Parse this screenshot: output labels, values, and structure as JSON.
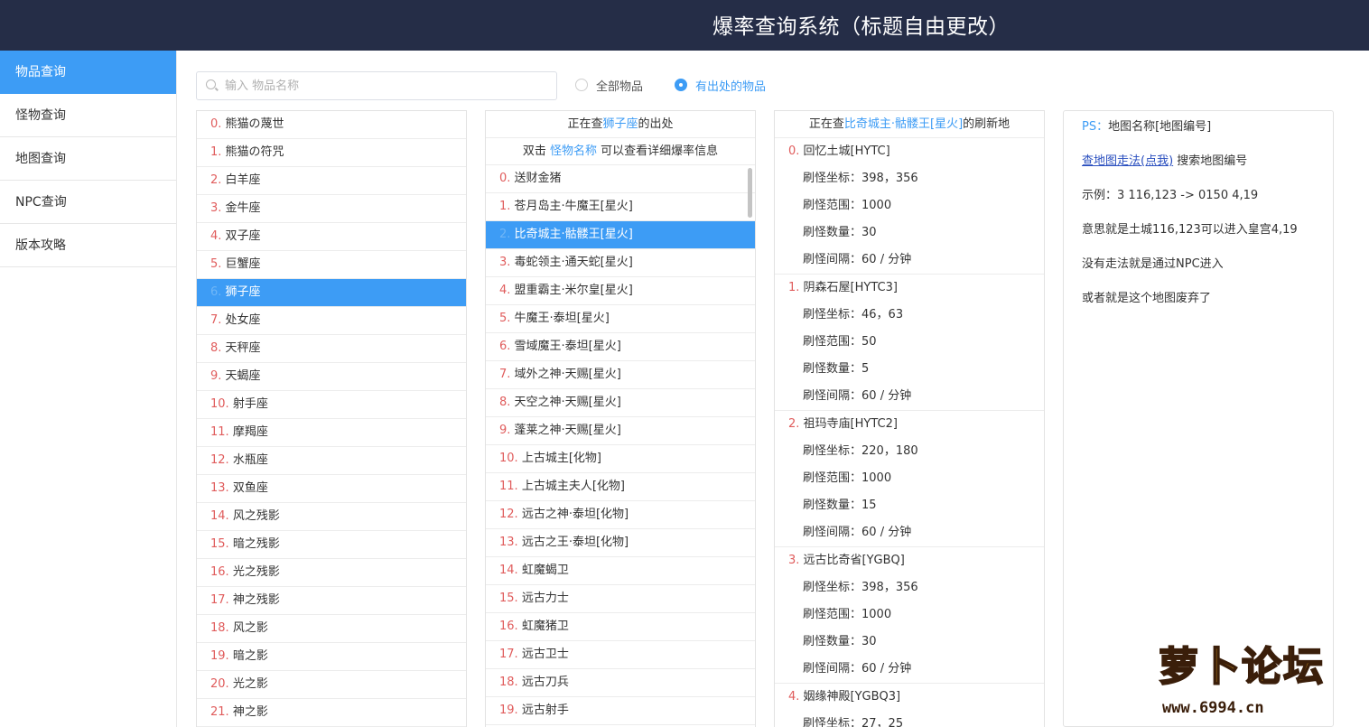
{
  "app": {
    "title": "爆率查询系统（标题自由更改）"
  },
  "sidebar": {
    "items": [
      {
        "label": "物品查询",
        "active": true
      },
      {
        "label": "怪物查询"
      },
      {
        "label": "地图查询"
      },
      {
        "label": "NPC查询"
      },
      {
        "label": "版本攻略"
      }
    ]
  },
  "search": {
    "placeholder": "输入 物品名称",
    "value": ""
  },
  "filters": {
    "all_label": "全部物品",
    "has_source_label": "有出处的物品",
    "selected": "has_source"
  },
  "items": {
    "selected_index": 6,
    "list": [
      "熊猫の蔑世",
      "熊猫の符咒",
      "白羊座",
      "金牛座",
      "双子座",
      "巨蟹座",
      "狮子座",
      "处女座",
      "天秤座",
      "天蝎座",
      "射手座",
      "摩羯座",
      "水瓶座",
      "双鱼座",
      "风之残影",
      "暗之残影",
      "光之残影",
      "神之残影",
      "风之影",
      "暗之影",
      "光之影",
      "神之影"
    ]
  },
  "sources": {
    "header_prefix": "正在查",
    "header_item": "狮子座",
    "header_suffix": "的出处",
    "hint_prefix": "双击",
    "hint_link": "怪物名称",
    "hint_suffix": "可以查看详细爆率信息",
    "selected_index": 2,
    "list": [
      "送财金猪",
      "苍月岛主·牛魔王[星火]",
      "比奇城主·骷髅王[星火]",
      "毒蛇领主·通天蛇[星火]",
      "盟重霸主·米尔皇[星火]",
      "牛魔王·泰坦[星火]",
      "雪域魔王·泰坦[星火]",
      "域外之神·天赐[星火]",
      "天空之神·天赐[星火]",
      "蓬莱之神·天赐[星火]",
      "上古城主[化物]",
      "上古城主夫人[化物]",
      "远古之神·泰坦[化物]",
      "远古之王·泰坦[化物]",
      "虹魔蝎卫",
      "远古力士",
      "虹魔猪卫",
      "远古卫士",
      "远古刀兵",
      "远古射手"
    ]
  },
  "spawns": {
    "header_prefix": "正在查",
    "header_monster": "比奇城主·骷髅王[星火]",
    "header_suffix": "的刷新地",
    "labels": {
      "coords": "刷怪坐标：",
      "range": "刷怪范围：",
      "count": "刷怪数量：",
      "interval": "刷怪间隔："
    },
    "list": [
      {
        "name": "回忆土城[HYTC]",
        "coords": "398，356",
        "range": "1000",
        "count": "30",
        "interval": "60 / 分钟"
      },
      {
        "name": "阴森石屋[HYTC3]",
        "coords": "46，63",
        "range": "50",
        "count": "5",
        "interval": "60 / 分钟"
      },
      {
        "name": "祖玛寺庙[HYTC2]",
        "coords": "220，180",
        "range": "1000",
        "count": "15",
        "interval": "60 / 分钟"
      },
      {
        "name": "远古比奇省[YGBQ]",
        "coords": "398，356",
        "range": "1000",
        "count": "30",
        "interval": "60 / 分钟"
      },
      {
        "name": "姻缘神殿[YGBQ3]",
        "coords": "27，25"
      }
    ]
  },
  "notes": {
    "ps_label": "PS：",
    "ps_text": "地图名称[地图编号]",
    "link_text": "查地图走法(点我)",
    "link_suffix": " 搜索地图编号",
    "example": "示例：3 116,123 -> 0150 4,19",
    "meaning": "意思就是土城116,123可以进入皇宫4,19",
    "no_route": "没有走法就是通过NPC进入",
    "abandoned": "或者就是这个地图废弃了"
  },
  "watermark": {
    "logo_text": "萝卜论坛",
    "url": "www.6994.cn"
  },
  "colors": {
    "header_bg": "#252d47",
    "accent": "#3d9cf5",
    "index": "#e05c5c",
    "link": "#2a4fbf"
  }
}
